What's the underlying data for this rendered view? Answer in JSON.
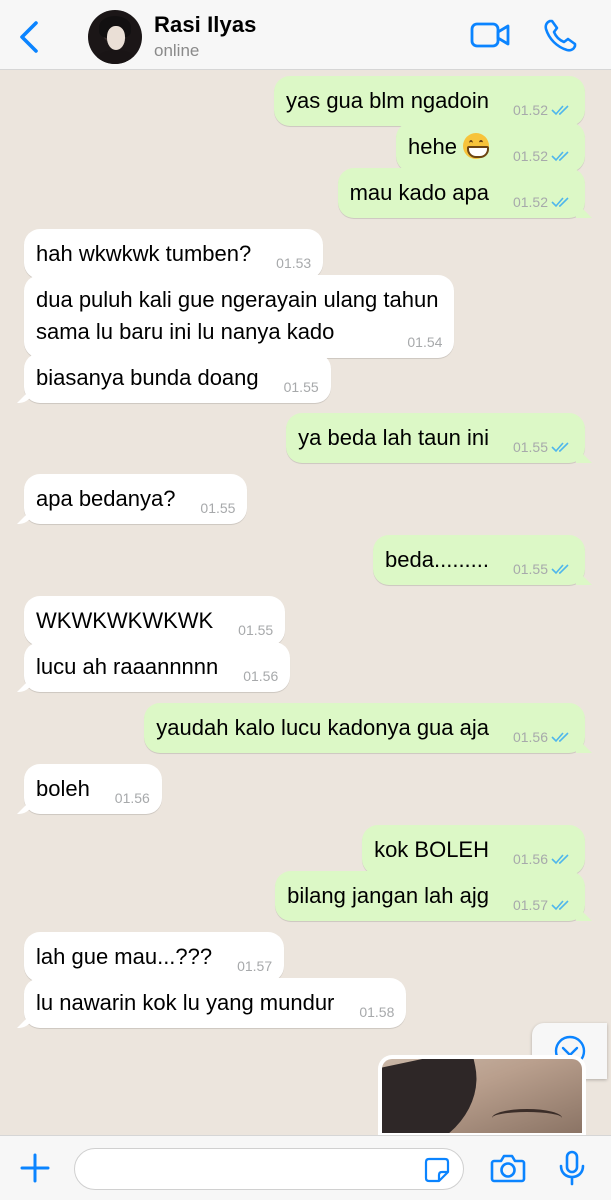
{
  "header": {
    "name": "Rasi Ilyas",
    "status": "online"
  },
  "colors": {
    "accent": "#0b84ff",
    "outgoing_bubble": "#dcf8c6",
    "incoming_bubble": "#ffffff",
    "background": "#ece5dd"
  },
  "messages": [
    {
      "dir": "out",
      "text": "yas gua blm ngadoin",
      "time": "01.52"
    },
    {
      "dir": "out",
      "text": "hehe",
      "time": "01.52",
      "emoji": "grinning-face"
    },
    {
      "dir": "out",
      "text": "mau kado apa",
      "time": "01.52"
    },
    {
      "dir": "in",
      "text": "hah wkwkwk tumben?",
      "time": "01.53"
    },
    {
      "dir": "in",
      "line1": "dua puluh kali gue ngerayain ulang tahun",
      "line2": "sama lu baru ini lu nanya kado",
      "time": "01.54"
    },
    {
      "dir": "in",
      "text": "biasanya bunda doang",
      "time": "01.55"
    },
    {
      "dir": "out",
      "text": "ya beda lah taun ini",
      "time": "01.55"
    },
    {
      "dir": "in",
      "text": "apa bedanya?",
      "time": "01.55"
    },
    {
      "dir": "out",
      "text": "beda.........",
      "time": "01.55"
    },
    {
      "dir": "in",
      "text": "WKWKWKWKWK",
      "time": "01.55"
    },
    {
      "dir": "in",
      "text": "lucu ah raaannnnn",
      "time": "01.56"
    },
    {
      "dir": "out",
      "text": "yaudah kalo lucu kadonya gua aja",
      "time": "01.56"
    },
    {
      "dir": "in",
      "text": "boleh",
      "time": "01.56"
    },
    {
      "dir": "out",
      "text": "kok BOLEH",
      "time": "01.56"
    },
    {
      "dir": "out",
      "text": "bilang jangan lah ajg",
      "time": "01.57"
    },
    {
      "dir": "in",
      "text": "lah gue mau...???",
      "time": "01.57"
    },
    {
      "dir": "in",
      "text": "lu nawarin kok lu yang mundur",
      "time": "01.58"
    }
  ],
  "input": {
    "value": ""
  },
  "icons": {
    "back": "chevron-left-icon",
    "video": "video-camera-icon",
    "call": "phone-icon",
    "scroll": "chevron-down-icon",
    "attach": "plus-icon",
    "sticker": "sticker-icon",
    "camera": "camera-icon",
    "mic": "microphone-icon"
  }
}
